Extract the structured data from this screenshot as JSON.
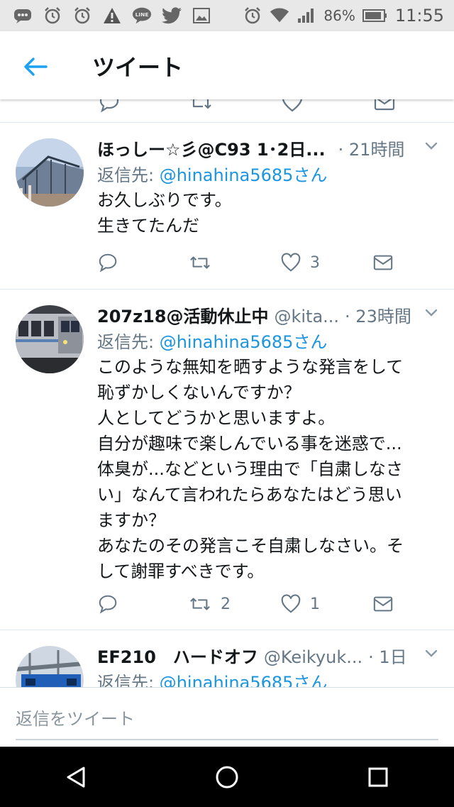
{
  "status_bar": {
    "battery": "86%",
    "time": "11:55",
    "left_icons": [
      "messenger-icon",
      "alarm-icon",
      "alarm-icon",
      "warning-icon",
      "line-icon",
      "twitter-icon",
      "image-icon"
    ],
    "line_label": "LINE"
  },
  "header": {
    "title": "ツイート"
  },
  "tweets": [
    {
      "name": "ほっしー☆彡@C93 1･2日...",
      "handle": "",
      "time": "· 21時間",
      "reply_prefix": "返信先: ",
      "reply_to": "@hinahina5685さん",
      "text": "お久しぶりです。\n生きてたんだ",
      "retweets": "",
      "likes": "3"
    },
    {
      "name": "207z18@活動休止中",
      "handle": "@kita...",
      "time": "· 23時間",
      "reply_prefix": "返信先: ",
      "reply_to": "@hinahina5685さん",
      "text": "このような無知を晒すような発言をして\n恥ずかしくないんですか？\n人としてどうかと思いますよ。\n自分が趣味で楽しんでいる事を迷惑で...\n体臭が...などという理由で「自粛しなさ\nい」なんて言われたらあなたはどう思い\nますか？\nあなたのその発言こそ自粛しなさい。そ\nして謝罪すべきです。",
      "retweets": "2",
      "likes": "1"
    },
    {
      "name": "EF210　ハードオフ",
      "handle": "@Keikyuk...",
      "time": "· 1日",
      "reply_prefix": "返信先: ",
      "reply_to": "@hinahina5685さん",
      "text": "",
      "retweets": "",
      "likes": ""
    }
  ],
  "composer": {
    "placeholder": "返信をツイート"
  },
  "colors": {
    "accent": "#1da1f2",
    "link": "#1b95e0",
    "muted": "#657786"
  }
}
